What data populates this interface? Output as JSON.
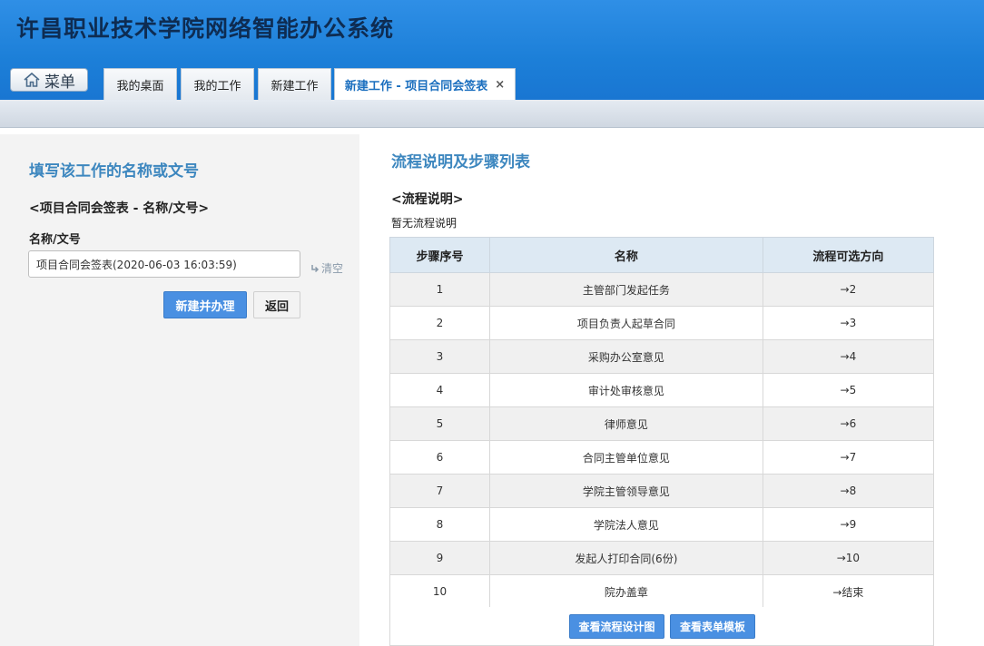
{
  "header": {
    "app_title": "许昌职业技术学院网络智能办公系统",
    "menu_label": "菜单",
    "home_icon": "home-icon",
    "tabs": [
      {
        "label": "我的桌面"
      },
      {
        "label": "我的工作"
      },
      {
        "label": "新建工作"
      },
      {
        "label": "新建工作 - 项目合同会签表",
        "close": "×"
      }
    ]
  },
  "left": {
    "title": "填写该工作的名称或文号",
    "subtitle": "<项目合同会签表 - 名称/文号>",
    "field_label": "名称/文号",
    "field_value": "项目合同会签表(2020-06-03 16:03:59)",
    "clear_label": "清空",
    "submit_label": "新建并办理",
    "back_label": "返回"
  },
  "right": {
    "title": "流程说明及步骤列表",
    "section_head": "<流程说明>",
    "section_desc": "暂无流程说明",
    "columns": [
      "步骤序号",
      "名称",
      "流程可选方向"
    ],
    "rows": [
      {
        "num": "1",
        "name": "主管部门发起任务",
        "dir": "→2"
      },
      {
        "num": "2",
        "name": "项目负责人起草合同",
        "dir": "→3"
      },
      {
        "num": "3",
        "name": "采购办公室意见",
        "dir": "→4"
      },
      {
        "num": "4",
        "name": "审计处审核意见",
        "dir": "→5"
      },
      {
        "num": "5",
        "name": "律师意见",
        "dir": "→6"
      },
      {
        "num": "6",
        "name": "合同主管单位意见",
        "dir": "→7"
      },
      {
        "num": "7",
        "name": "学院主管领导意见",
        "dir": "→8"
      },
      {
        "num": "8",
        "name": "学院法人意见",
        "dir": "→9"
      },
      {
        "num": "9",
        "name": "发起人打印合同(6份)",
        "dir": "→10"
      },
      {
        "num": "10",
        "name": "院办盖章",
        "dir": "→结束"
      }
    ],
    "btn_flowchart": "查看流程设计图",
    "btn_template": "查看表单模板"
  }
}
